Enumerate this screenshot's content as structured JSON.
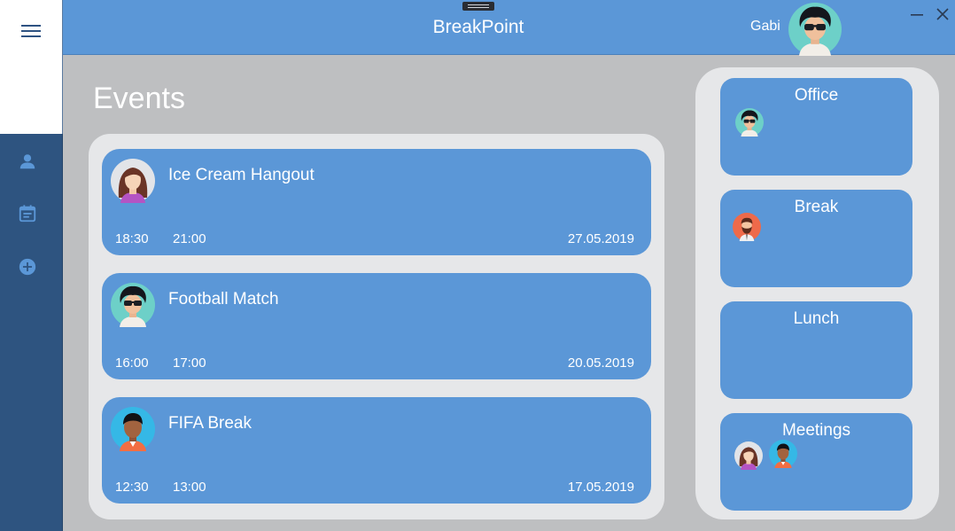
{
  "header": {
    "app_title": "BreakPoint",
    "user_name": "Gabi"
  },
  "sidebar": {
    "items": [
      "menu-icon",
      "person-icon",
      "calendar-icon",
      "add-circle-icon"
    ]
  },
  "page": {
    "title": "Events"
  },
  "events": [
    {
      "title": "Ice Cream Hangout",
      "start": "18:30",
      "end": "21:00",
      "date": "27.05.2019",
      "avatar": "woman-long-hair"
    },
    {
      "title": "Football Match",
      "start": "16:00",
      "end": "17:00",
      "date": "20.05.2019",
      "avatar": "man-afro-sunglasses"
    },
    {
      "title": "FIFA Break",
      "start": "12:30",
      "end": "13:00",
      "date": "17.05.2019",
      "avatar": "man-dark-skin"
    }
  ],
  "rooms": [
    {
      "name": "Office",
      "members": [
        "man-afro-sunglasses"
      ]
    },
    {
      "name": "Break",
      "members": [
        "man-bearded"
      ]
    },
    {
      "name": "Lunch",
      "members": []
    },
    {
      "name": "Meetings",
      "members": [
        "woman-long-hair",
        "man-dark-skin"
      ]
    }
  ],
  "colors": {
    "accent": "#5b97d7",
    "sidebar": "#2e5480",
    "background": "#bebfc1",
    "panel": "#e6e7e9"
  }
}
